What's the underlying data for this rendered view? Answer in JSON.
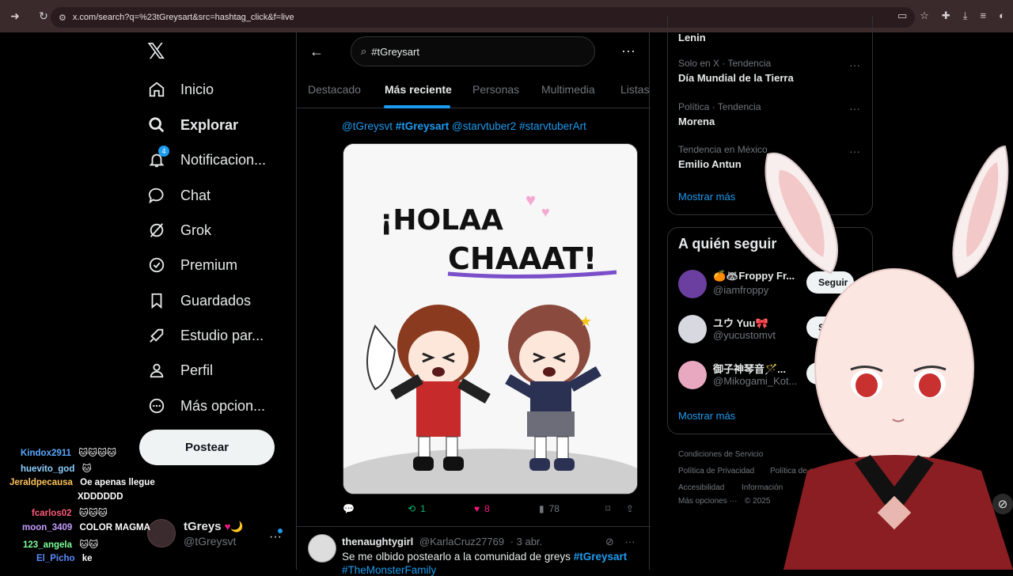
{
  "browser": {
    "url": "x.com/search?q=%23tGreysart&src=hashtag_click&f=live"
  },
  "nav": {
    "items": [
      {
        "label": "Inicio",
        "icon": "home-icon"
      },
      {
        "label": "Explorar",
        "icon": "search-icon"
      },
      {
        "label": "Notificacion...",
        "icon": "bell-icon",
        "badge": "4"
      },
      {
        "label": "Chat",
        "icon": "chat-icon"
      },
      {
        "label": "Grok",
        "icon": "grok-icon"
      },
      {
        "label": "Premium",
        "icon": "premium-icon"
      },
      {
        "label": "Guardados",
        "icon": "bookmark-icon"
      },
      {
        "label": "Estudio par...",
        "icon": "rocket-icon"
      },
      {
        "label": "Perfil",
        "icon": "person-icon"
      },
      {
        "label": "Más opcion...",
        "icon": "more-circle-icon"
      }
    ],
    "post_button": "Postear"
  },
  "me": {
    "name": "tGreys",
    "emoji": "♥🌙",
    "handle": "@tGreysvt"
  },
  "chat": [
    {
      "user": "Kindox2911",
      "msg": "",
      "color": "#5aa8ff"
    },
    {
      "user": "huevito_god",
      "msg": "",
      "color": "#8fd0ff"
    },
    {
      "user": "Jeraldpecausa",
      "msg": "Oe apenas llegue",
      "color": "#ffc35a"
    },
    {
      "user": "",
      "msg": "XDDDDDD",
      "color": "#ffffff"
    },
    {
      "user": "fcarlos02",
      "msg": "",
      "color": "#ff5a7a"
    },
    {
      "user": "moon_3409",
      "msg": "COLOR MAGMA",
      "color": "#c59bff"
    },
    {
      "user": "123_angela",
      "msg": "",
      "color": "#7dff9b"
    },
    {
      "user": "El_Picho",
      "msg": "ke",
      "color": "#5a8cff"
    }
  ],
  "search": {
    "query": "#tGreysart"
  },
  "tabs": [
    "Destacado",
    "Más reciente",
    "Personas",
    "Multimedia",
    "Listas"
  ],
  "tweet1": {
    "mention1": "@tGreysvt",
    "hashtag": "#tGreysart",
    "mention2": "@starvtuber2",
    "hashtag2": "#starvtuberArt",
    "image_text_line1": "¡HOLAA",
    "image_text_line2": "CHAAAT!",
    "replies": "",
    "retweets": "1",
    "likes": "8",
    "views": "78"
  },
  "tweet2": {
    "name": "thenaughtygirl",
    "handle": "@KarlaCruz27769",
    "date": "· 3 abr.",
    "text": "Se me olbido postearlo a la comunidad de greys",
    "hashtag": "#tGreysart",
    "text2": "#TheMonsterFamily"
  },
  "trends": [
    {
      "context": "",
      "title": "Lenin"
    },
    {
      "context": "Solo en X · Tendencia",
      "title": "Día Mundial de la Tierra"
    },
    {
      "context": "Política · Tendencia",
      "title": "Morena"
    },
    {
      "context": "Tendencia en México",
      "title": "Emilio Antun"
    }
  ],
  "show_more": "Mostrar más",
  "who_to_follow": {
    "title": "A quién seguir",
    "people": [
      {
        "name": "🍊🦝Froppy Fr...",
        "handle": "@iamfroppy",
        "follow": "Seguir"
      },
      {
        "name": "ユウ Yuu🎀",
        "handle": "@yucustomvt",
        "follow": "Seguir"
      },
      {
        "name": "御子神琴音🪄...",
        "handle": "@Mikogami_Kot...",
        "follow": "Seguir"
      }
    ],
    "show_more": "Mostrar más"
  },
  "footer": {
    "terms": "Condiciones de Servicio",
    "privacy": "Política de Privacidad",
    "cookies": "Política de cookies",
    "accessibility": "Accesibilidad",
    "info": "Información",
    "more": "Más opciones ···",
    "copyright": "© 2025"
  },
  "colors": {
    "accent": "#1d9bf0",
    "chrome": "#3a2a2c",
    "background": "#000000",
    "like": "#f91880",
    "retweet": "#00ba7c"
  }
}
